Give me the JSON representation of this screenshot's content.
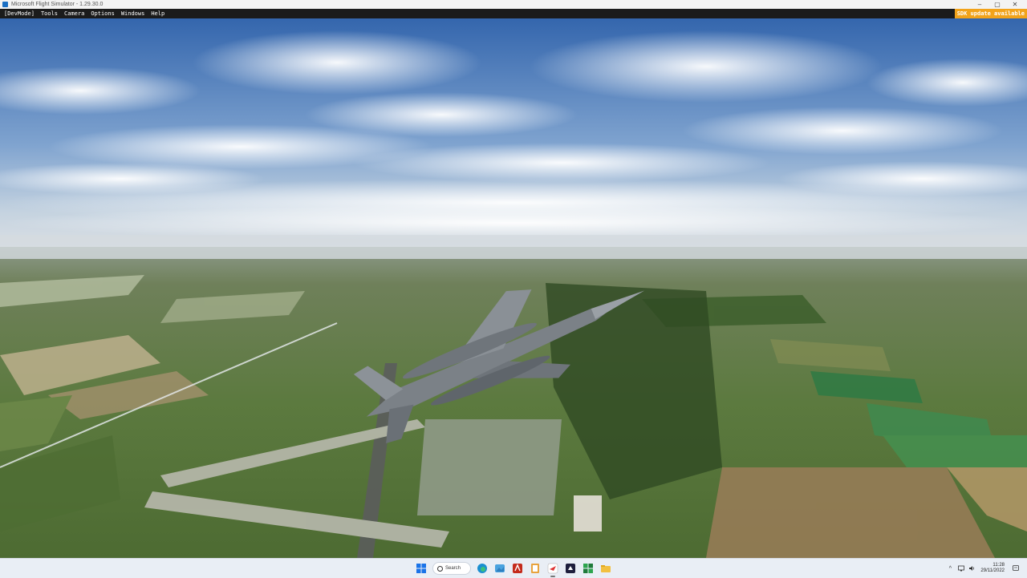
{
  "window": {
    "title": "Microsoft Flight Simulator - 1.29.30.0",
    "min_glyph": "–",
    "max_glyph": "▢",
    "close_glyph": "✕"
  },
  "devbar": {
    "menu": [
      "[DevMode]",
      "Tools",
      "Camera",
      "Options",
      "Windows",
      "Help"
    ],
    "sdk_notice": "SDK update available",
    "sdk_color": "#f2a31a"
  },
  "scene": {
    "description_icon": "flight-view-icon",
    "sky_top": "#3c6fb0",
    "horizon": "#cfd7de",
    "ground": "#5f7d45"
  },
  "taskbar": {
    "search_label": "Search",
    "apps": [
      "windows-start-icon",
      "search",
      "edge-icon",
      "photos-icon",
      "office-icon",
      "notebook-icon",
      "flight-simulator-icon",
      "devmode-icon",
      "xbox-icon",
      "file-explorer-icon"
    ],
    "clock_time": "11:28",
    "clock_date": "29/11/2022"
  }
}
